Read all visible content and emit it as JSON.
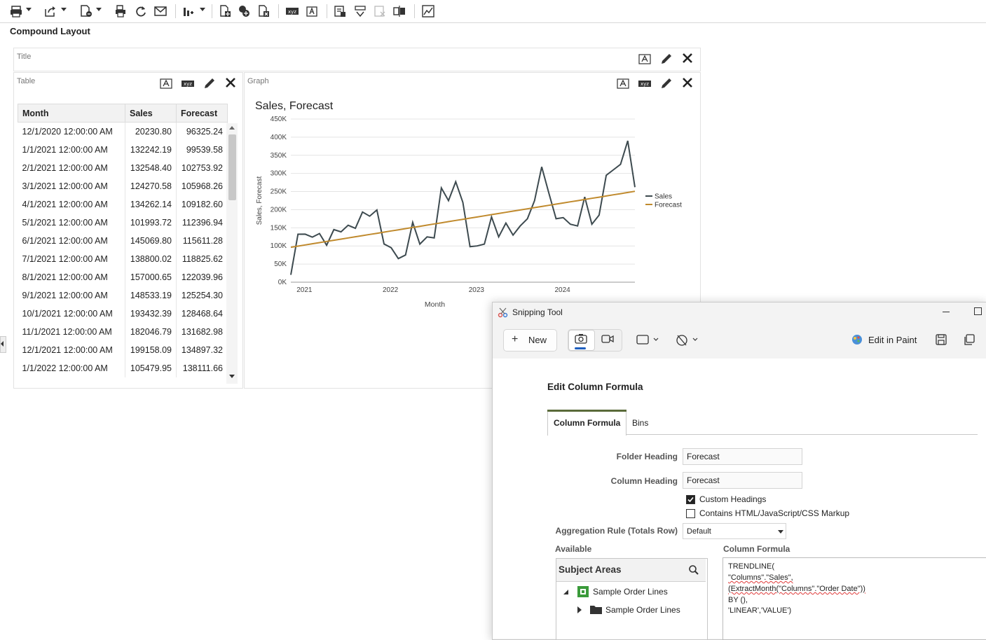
{
  "page_title": "Compound Layout",
  "toolbar_icons": [
    "print-icon",
    "export-icon",
    "refresh-views-icon",
    "print-view-icon",
    "refresh-icon",
    "email-icon",
    "chart-type-icon",
    "add-view-icon",
    "add-filter-icon",
    "add-section-icon",
    "xyz-format-icon",
    "text-format-icon",
    "insert-view-icon",
    "ungroup-icon",
    "delete-view-icon",
    "split-view-icon",
    "chart-edit-icon"
  ],
  "title_panel": {
    "label": "Title"
  },
  "table_panel": {
    "label": "Table",
    "columns": [
      "Month",
      "Sales",
      "Forecast"
    ],
    "rows": [
      [
        "12/1/2020 12:00:00 AM",
        "20230.80",
        "96325.24"
      ],
      [
        "1/1/2021 12:00:00 AM",
        "132242.19",
        "99539.58"
      ],
      [
        "2/1/2021 12:00:00 AM",
        "132548.40",
        "102753.92"
      ],
      [
        "3/1/2021 12:00:00 AM",
        "124270.58",
        "105968.26"
      ],
      [
        "4/1/2021 12:00:00 AM",
        "134262.14",
        "109182.60"
      ],
      [
        "5/1/2021 12:00:00 AM",
        "101993.72",
        "112396.94"
      ],
      [
        "6/1/2021 12:00:00 AM",
        "145069.80",
        "115611.28"
      ],
      [
        "7/1/2021 12:00:00 AM",
        "138800.02",
        "118825.62"
      ],
      [
        "8/1/2021 12:00:00 AM",
        "157000.65",
        "122039.96"
      ],
      [
        "9/1/2021 12:00:00 AM",
        "148533.19",
        "125254.30"
      ],
      [
        "10/1/2021 12:00:00 AM",
        "193432.39",
        "128468.64"
      ],
      [
        "11/1/2021 12:00:00 AM",
        "182046.79",
        "131682.98"
      ],
      [
        "12/1/2021 12:00:00 AM",
        "199158.09",
        "134897.32"
      ],
      [
        "1/1/2022 12:00:00 AM",
        "105479.95",
        "138111.66"
      ]
    ]
  },
  "graph_panel": {
    "label": "Graph"
  },
  "chart_data": {
    "type": "line",
    "title": "Sales, Forecast",
    "xlabel": "Month",
    "ylabel": "Sales, Forecast",
    "x_ticks": [
      "2021",
      "2022",
      "2023",
      "2024"
    ],
    "y_ticks": [
      "0K",
      "50K",
      "100K",
      "150K",
      "200K",
      "250K",
      "300K",
      "350K",
      "400K",
      "450K"
    ],
    "ylim": [
      0,
      450000
    ],
    "legend_position": "right",
    "colors": {
      "Sales": "#3d4a4f",
      "Forecast": "#c08a2d"
    },
    "series": [
      {
        "name": "Sales",
        "values": [
          20231,
          132242,
          132548,
          124271,
          134262,
          101994,
          145070,
          138800,
          157001,
          148533,
          193432,
          182047,
          199158,
          105480,
          95000,
          65000,
          75000,
          165000,
          105000,
          125000,
          122000,
          260000,
          225000,
          277000,
          220000,
          98000,
          100000,
          105000,
          180000,
          125000,
          163000,
          130000,
          155000,
          175000,
          225000,
          318000,
          245000,
          175000,
          178000,
          160000,
          155000,
          235000,
          160000,
          185000,
          295000,
          310000,
          325000,
          390000,
          262000
        ]
      },
      {
        "name": "Forecast",
        "values": [
          96325,
          99540,
          102754,
          105968,
          109183,
          112397,
          115611,
          118826,
          122040,
          125254,
          128469,
          131683,
          134897,
          138112,
          141326,
          144540,
          147755,
          150969,
          154183,
          157398,
          160612,
          163826,
          167041,
          170255,
          173469,
          176684,
          179898,
          183112,
          186327,
          189541,
          192755,
          195970,
          199184,
          202398,
          205613,
          208827,
          212041,
          215256,
          218470,
          221684,
          224899,
          228113,
          231327,
          234542,
          237756,
          240970,
          244185,
          247399,
          250613
        ]
      }
    ]
  },
  "snipping_tool": {
    "title": "Snipping Tool",
    "new_label": "New",
    "edit_in_paint_label": "Edit in Paint"
  },
  "edit_formula": {
    "title": "Edit Column Formula",
    "tabs": [
      "Column Formula",
      "Bins"
    ],
    "folder_heading_label": "Folder Heading",
    "folder_heading_value": "Forecast",
    "column_heading_label": "Column Heading",
    "column_heading_value": "Forecast",
    "custom_headings_label": "Custom Headings",
    "custom_headings_checked": true,
    "markup_label": "Contains HTML/JavaScript/CSS Markup",
    "markup_checked": false,
    "aggregation_label": "Aggregation Rule (Totals Row)",
    "aggregation_value": "Default",
    "available_label": "Available",
    "column_formula_label": "Column Formula",
    "subject_areas_label": "Subject Areas",
    "tree": [
      "Sample Order Lines",
      "Sample Order Lines"
    ],
    "formula_lines": [
      "TRENDLINE(",
      "\"Columns\".\"Sales\",",
      "(ExtractMonth(\"Columns\".\"Order Date\"))",
      "BY (),",
      "'LINEAR','VALUE')"
    ]
  }
}
